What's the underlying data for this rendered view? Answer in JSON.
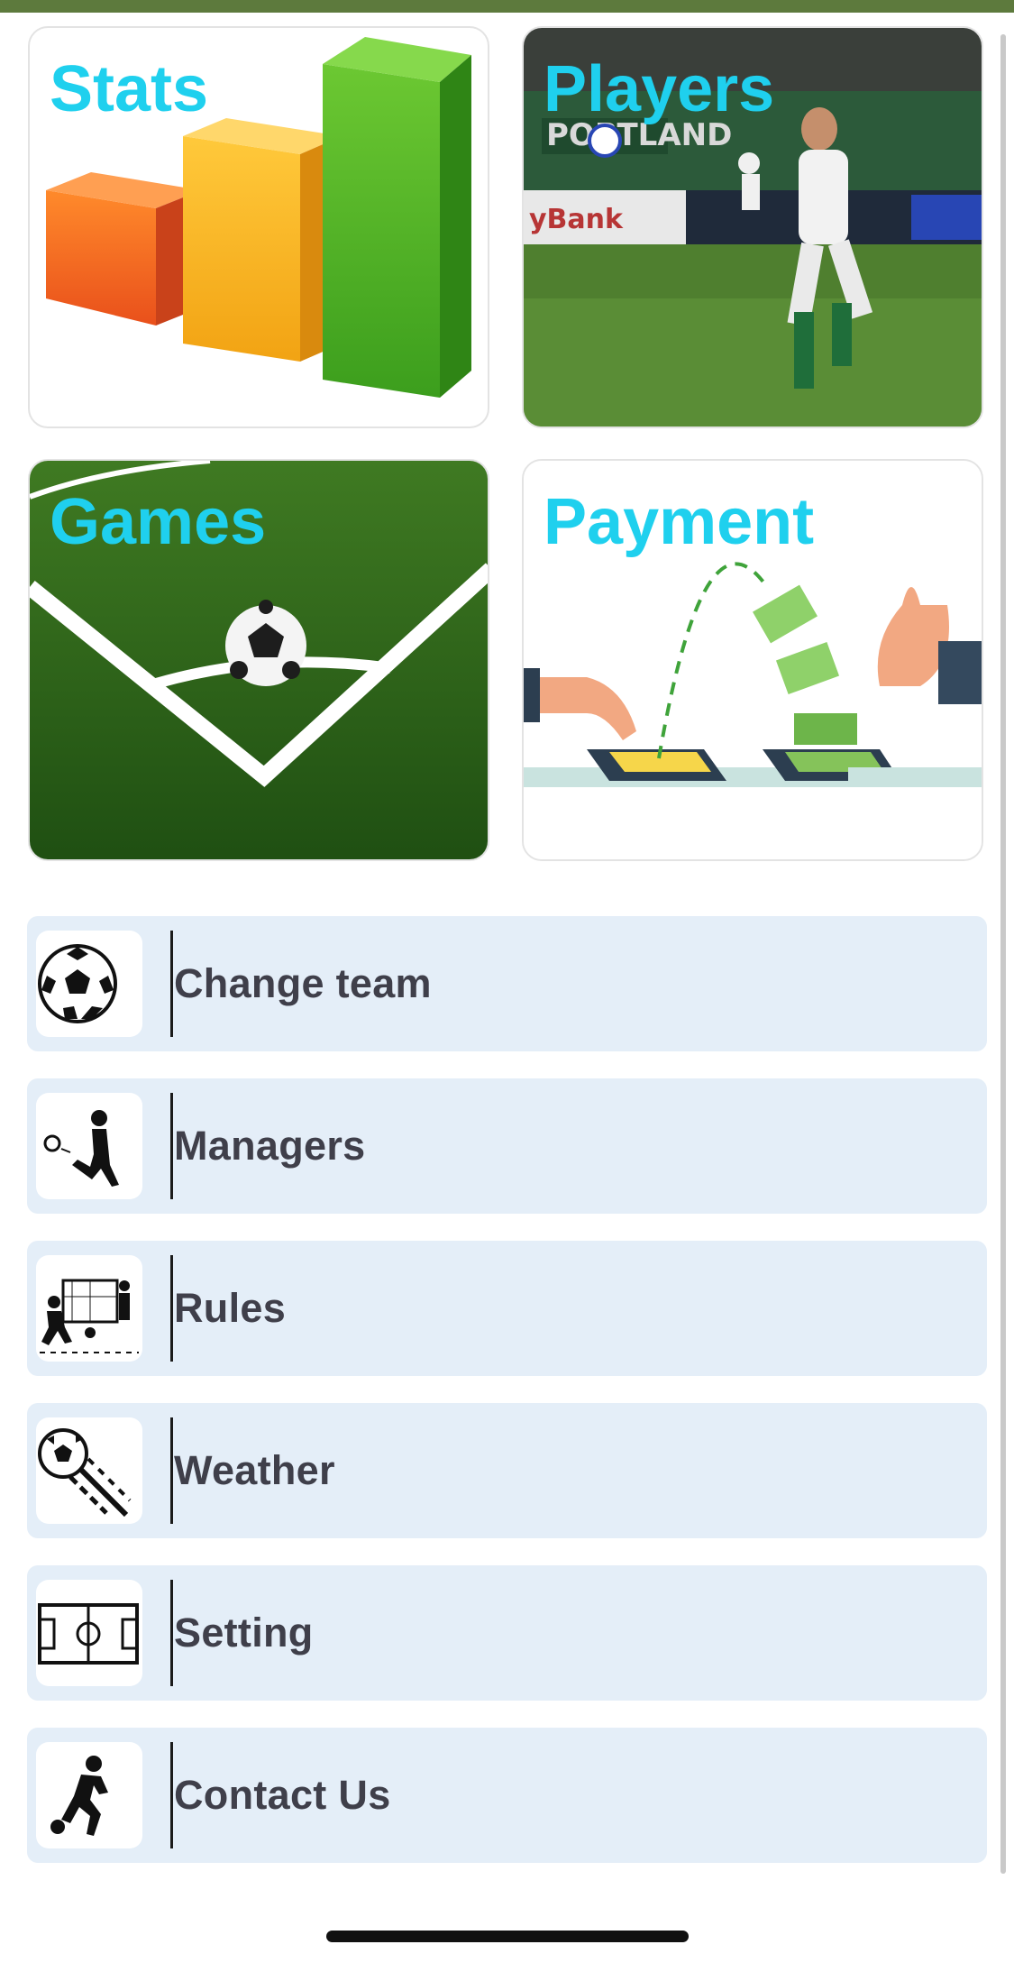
{
  "tiles": {
    "stats": "Stats",
    "players": "Players",
    "games": "Games",
    "payment": "Payment"
  },
  "menu": [
    {
      "label": "Change team",
      "icon": "soccer-ball-icon"
    },
    {
      "label": "Managers",
      "icon": "kicking-player-icon"
    },
    {
      "label": "Rules",
      "icon": "players-goal-icon"
    },
    {
      "label": "Weather",
      "icon": "flying-ball-icon"
    },
    {
      "label": "Setting",
      "icon": "soccer-field-icon"
    },
    {
      "label": "Contact Us",
      "icon": "running-player-icon"
    }
  ],
  "colors": {
    "top_bar": "#5d7a3d",
    "tile_label": "#1fd0ee",
    "menu_row_bg": "#e4eef8",
    "menu_text": "#3f3f4a"
  }
}
